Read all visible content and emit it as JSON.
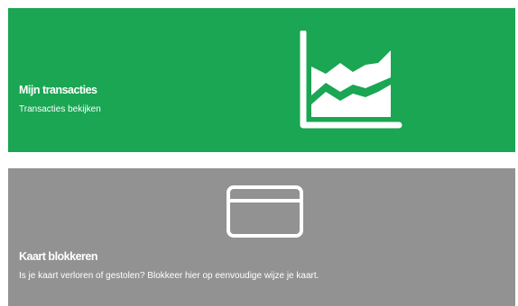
{
  "tiles": [
    {
      "title": "Mijn transacties",
      "description": "Transacties bekijken",
      "icon": "line-chart-icon",
      "background": "#1aa653"
    },
    {
      "title": "Kaart blokkeren",
      "description": "Is je kaart verloren of gestolen? Blokkeer hier op eenvoudige wijze je kaart.",
      "icon": "credit-card-icon",
      "background": "#929292"
    }
  ],
  "colors": {
    "page_background": "#ffffff",
    "text": "#ffffff"
  }
}
